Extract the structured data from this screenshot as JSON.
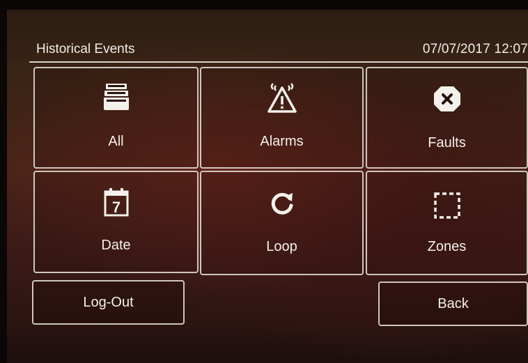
{
  "header": {
    "title": "Historical Events",
    "datetime": "07/07/2017 12:07"
  },
  "tiles": [
    {
      "label": "All",
      "icon": "inbox-tray-icon"
    },
    {
      "label": "Alarms",
      "icon": "alarm-warning-icon"
    },
    {
      "label": "Faults",
      "icon": "fault-x-icon"
    },
    {
      "label": "Date",
      "icon": "calendar-icon",
      "icon_text": "7"
    },
    {
      "label": "Loop",
      "icon": "refresh-loop-icon"
    },
    {
      "label": "Zones",
      "icon": "dashed-zone-icon"
    }
  ],
  "buttons": {
    "logout": "Log-Out",
    "back": "Back"
  },
  "colors": {
    "text": "#f4f1ec",
    "border": "#cfc7bf",
    "background": "#3a1a15"
  }
}
